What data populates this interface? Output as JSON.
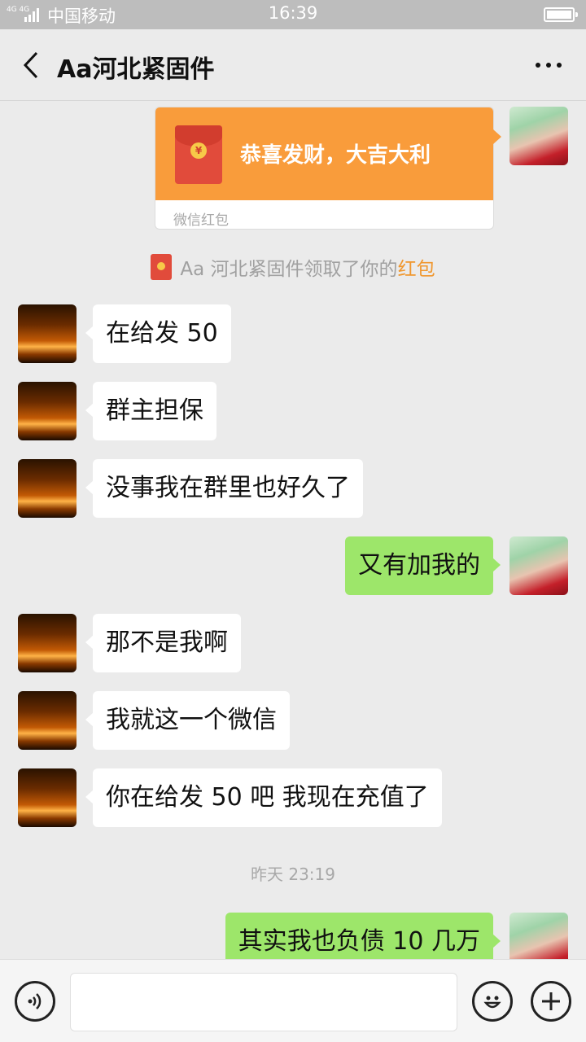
{
  "status_bar": {
    "network": "4G 4G",
    "carrier": "中国移动",
    "time": "16:39"
  },
  "header": {
    "title": "Aa河北紧固件",
    "back_icon": "chevron-left-icon",
    "more_icon": "more-dots-icon"
  },
  "messages": [
    {
      "side": "out",
      "type": "red_packet",
      "text": "恭喜发财，大吉大利",
      "label": "微信红包"
    },
    {
      "type": "system",
      "prefix": "Aa 河北紧固件领取了你的",
      "highlight": "红包"
    },
    {
      "side": "in",
      "text": "在给发 50"
    },
    {
      "side": "in",
      "text": "群主担保"
    },
    {
      "side": "in",
      "text": "没事我在群里也好久了"
    },
    {
      "side": "out",
      "text": "又有加我的"
    },
    {
      "side": "in",
      "text": "那不是我啊"
    },
    {
      "side": "in",
      "text": "我就这一个微信"
    },
    {
      "side": "in",
      "text": "你在给发 50 吧  我现在充值了"
    },
    {
      "type": "timestamp",
      "text": "昨天 23:19"
    },
    {
      "side": "out",
      "text": "其实我也负债 10 几万"
    }
  ],
  "input_bar": {
    "voice_icon": "voice-icon",
    "emoji_icon": "emoji-icon",
    "plus_icon": "plus-icon",
    "placeholder": ""
  },
  "colors": {
    "outgoing_bubble": "#9de66a",
    "incoming_bubble": "#ffffff",
    "red_packet": "#f99c3b",
    "highlight": "#f0962c",
    "background": "#ebebeb"
  }
}
